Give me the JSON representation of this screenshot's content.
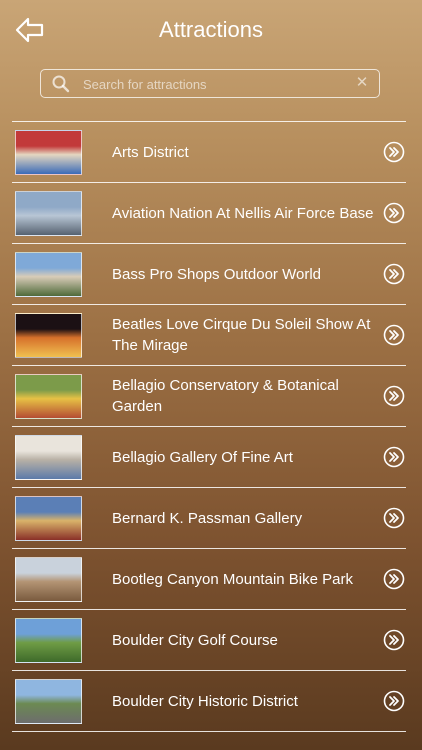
{
  "header": {
    "title": "Attractions",
    "back_icon": "back-arrow-icon"
  },
  "search": {
    "placeholder": "Search for attractions",
    "value": "",
    "clear_glyph": "✕"
  },
  "attractions": [
    {
      "name": "Arts District",
      "thumb": [
        "#c23a3a",
        "#e4d7c0",
        "#3b6bb8"
      ]
    },
    {
      "name": "Aviation Nation At Nellis Air Force Base",
      "thumb": [
        "#8fa9c7",
        "#b8c6d5",
        "#566270"
      ]
    },
    {
      "name": "Bass Pro Shops Outdoor World",
      "thumb": [
        "#7fa9d8",
        "#d8ccb8",
        "#4f6a3a"
      ]
    },
    {
      "name": "Beatles Love Cirque Du Soleil Show At The Mirage",
      "thumb": [
        "#1b1014",
        "#d6702b",
        "#f0c050"
      ]
    },
    {
      "name": "Bellagio Conservatory & Botanical Garden",
      "thumb": [
        "#7c9b4a",
        "#e7c145",
        "#b44c33"
      ]
    },
    {
      "name": "Bellagio Gallery Of Fine Art",
      "thumb": [
        "#e9e4dc",
        "#b9b1a6",
        "#5c7aa8"
      ]
    },
    {
      "name": "Bernard K. Passman Gallery",
      "thumb": [
        "#5b7fb6",
        "#d9b36a",
        "#8a3028"
      ]
    },
    {
      "name": "Bootleg Canyon Mountain Bike Park",
      "thumb": [
        "#c9d2dc",
        "#b39474",
        "#7a5a3e"
      ]
    },
    {
      "name": "Boulder City Golf Course",
      "thumb": [
        "#6ea0d8",
        "#6f9c45",
        "#3e6a2a"
      ]
    },
    {
      "name": "Boulder City Historic District",
      "thumb": [
        "#8fb6e0",
        "#6c8a52",
        "#6d6d6d"
      ]
    }
  ]
}
